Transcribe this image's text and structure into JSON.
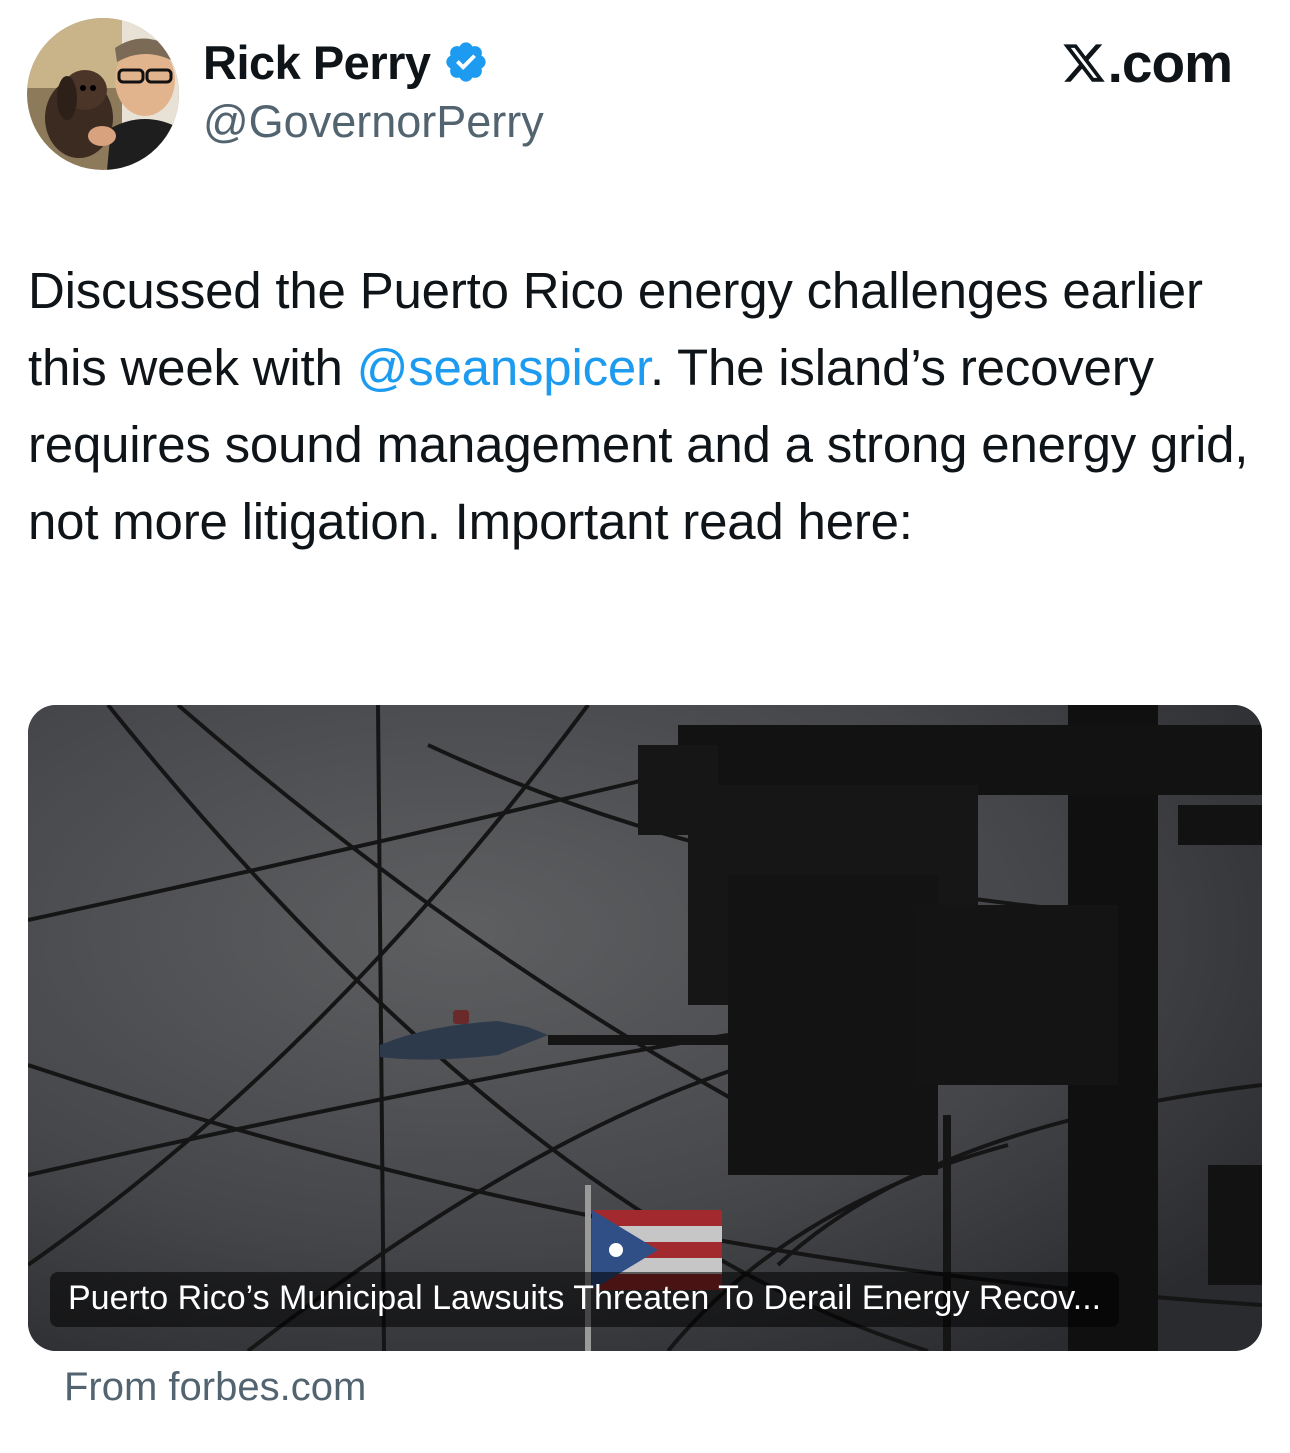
{
  "author": {
    "display_name": "Rick Perry",
    "handle": "@GovernorPerry",
    "verified": true,
    "avatar_icon": "profile-photo"
  },
  "brand": {
    "logo_icon": "x-logo-icon",
    "text": ".com"
  },
  "tweet": {
    "text_before_mention": "Discussed the Puerto Rico energy challenges earlier this week with ",
    "mention": "@seanspicer",
    "text_after_mention": ". The island’s recovery requires sound management and a strong energy grid, not more litigation. Important read here:"
  },
  "card": {
    "headline": "Puerto Rico’s Municipal Lawsuits Threaten To Derail Energy Recov...",
    "source": "From forbes.com",
    "image_icon": "power-lines-photo"
  },
  "colors": {
    "link": "#1d9bf0",
    "verified_badge": "#1d9bf0",
    "secondary_text": "#536471",
    "primary_text": "#0f1419"
  }
}
